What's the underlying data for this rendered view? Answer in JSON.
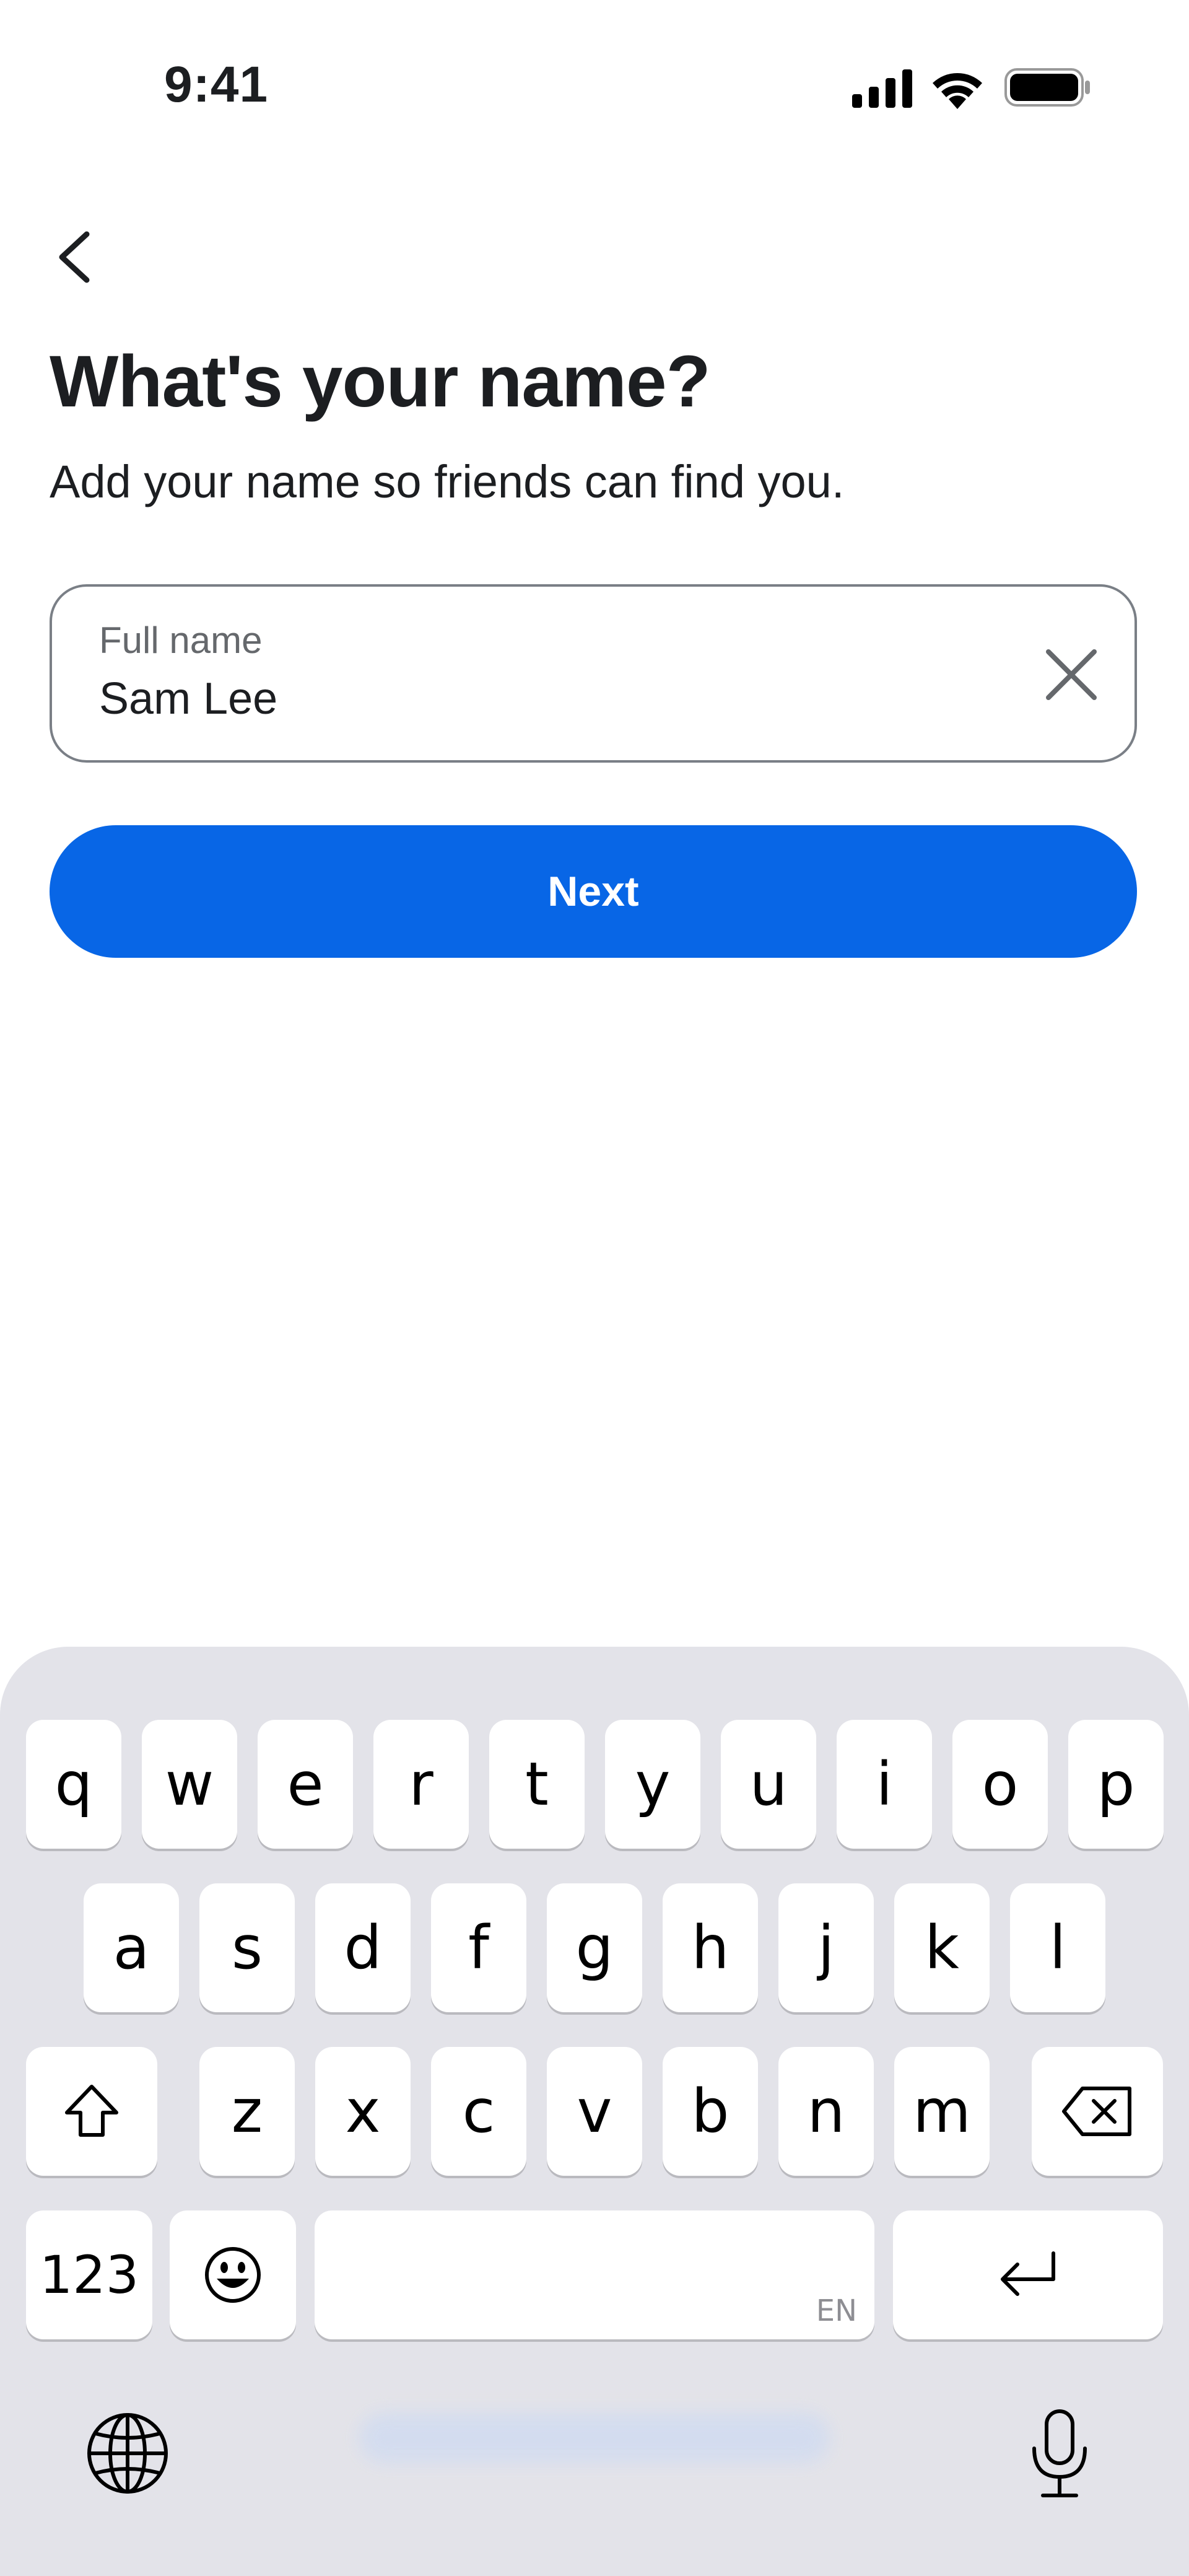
{
  "status_bar": {
    "time": "9:41"
  },
  "header": {
    "title": "What's your name?",
    "subtitle": "Add your name so friends can find you."
  },
  "name_field": {
    "label": "Full name",
    "value": "Sam Lee"
  },
  "next_button": {
    "label": "Next"
  },
  "keyboard": {
    "row1": [
      "q",
      "w",
      "e",
      "r",
      "t",
      "y",
      "u",
      "i",
      "o",
      "p"
    ],
    "row2": [
      "a",
      "s",
      "d",
      "f",
      "g",
      "h",
      "j",
      "k",
      "l"
    ],
    "row3": [
      "z",
      "x",
      "c",
      "v",
      "b",
      "n",
      "m"
    ],
    "numbers_key": "123",
    "space_language": "EN"
  },
  "colors": {
    "accent": "#0866e6",
    "keyboard_bg": "#e3e3e9"
  },
  "icons": [
    "back-arrow",
    "clear-x",
    "shift",
    "backspace",
    "emoji",
    "return",
    "globe",
    "microphone"
  ]
}
